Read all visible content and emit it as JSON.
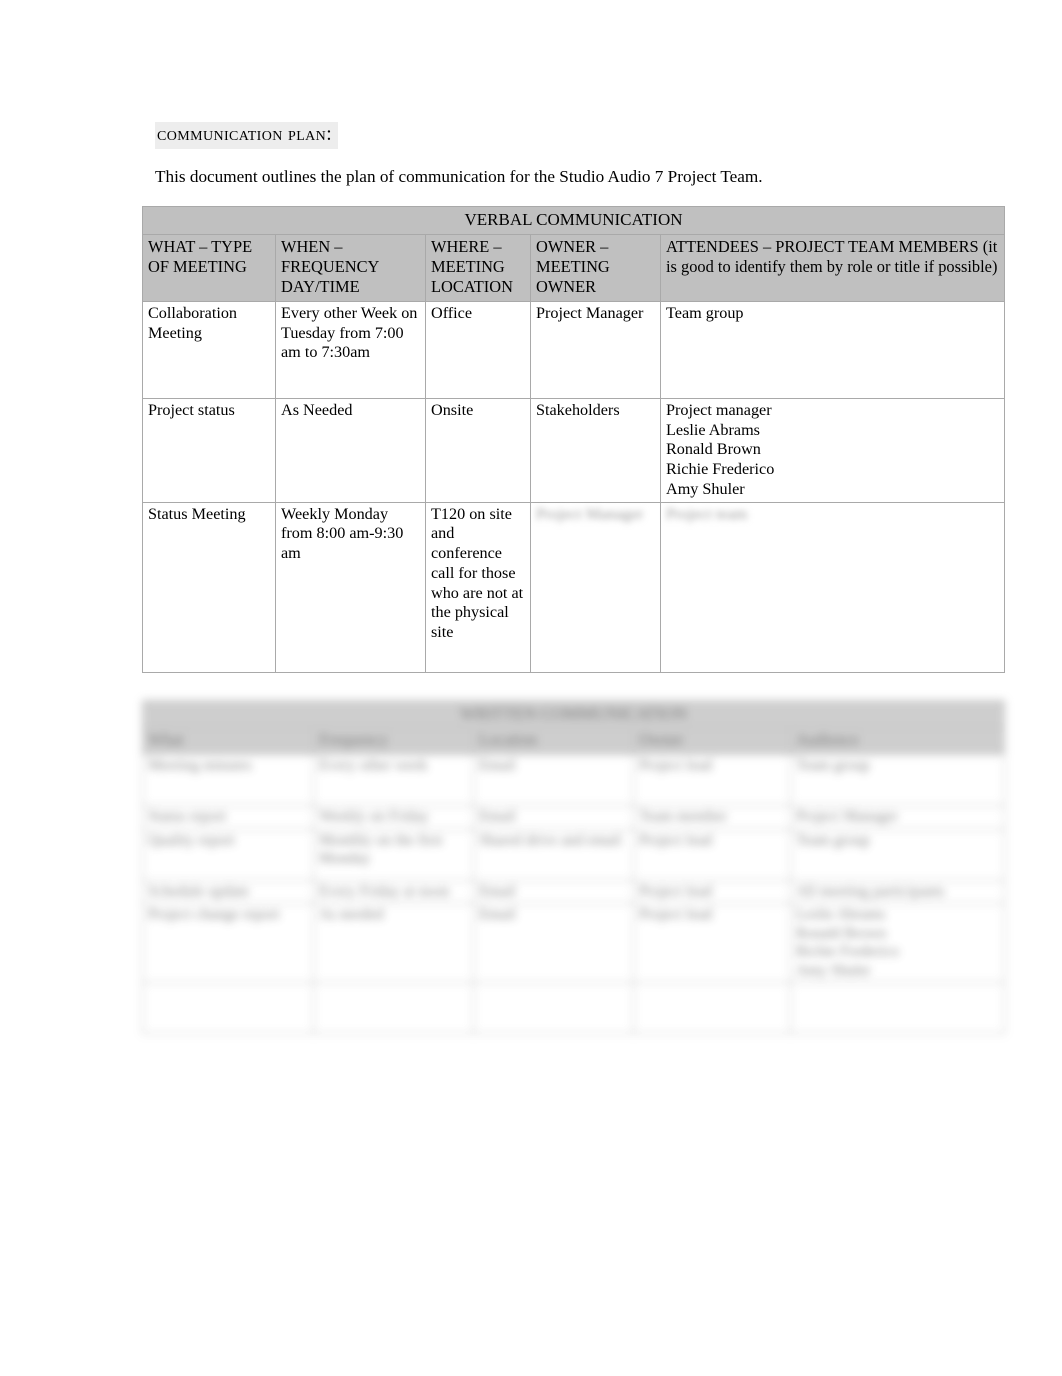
{
  "document": {
    "title": "Communication Plan:",
    "intro": "This document outlines the plan of communication for the Studio Audio 7 Project Team."
  },
  "colors": {
    "header_fill": "#c0c0c0",
    "border": "#a9a9a9",
    "title_shading": "#ededed",
    "text": "#000000"
  },
  "verbal_table": {
    "banner": "VERBAL COMMUNICATION",
    "columns": [
      "WHAT – TYPE OF MEETING",
      "WHEN – FREQUENCY DAY/TIME",
      "WHERE – MEETING LOCATION",
      "OWNER – MEETING OWNER",
      "ATTENDEES – PROJECT TEAM MEMBERS (it is good to identify them by role or title if possible)"
    ],
    "rows": [
      {
        "what": "Collaboration Meeting",
        "when": "Every other Week on Tuesday from 7:00 am to 7:30am",
        "where": "Office",
        "owner": "Project Manager",
        "attendees": "Team group"
      },
      {
        "what": "Project status",
        "when": "As Needed",
        "where": "Onsite",
        "owner": "Stakeholders",
        "attendees": "Project manager\nLeslie Abrams\nRonald Brown\nRichie Frederico\nAmy Shuler"
      },
      {
        "what": "Status Meeting",
        "when": "Weekly Monday from 8:00 am-9:30 am",
        "where": "T120 on site and conference call for those who are not at the physical site",
        "owner": "Project Manager",
        "attendees": "Project team"
      }
    ]
  },
  "written_table": {
    "banner": "WRITTEN COMMUNICATION",
    "illegible": true,
    "columns": [
      "What",
      "Frequency",
      "Location",
      "Owner",
      "Audience"
    ],
    "rows": [
      {
        "c1": "Meeting minutes",
        "c2": "Every other week",
        "c3": "Email",
        "c4": "Project lead",
        "c5": "Team group"
      },
      {
        "c1": "Status report",
        "c2": "Weekly on Friday",
        "c3": "Email",
        "c4": "Team member",
        "c5": "Project Manager"
      },
      {
        "c1": "Quality report",
        "c2": "Monthly on the first Monday",
        "c3": "Shared drive and email",
        "c4": "Project lead",
        "c5": "Team group"
      },
      {
        "c1": "Schedule update",
        "c2": "Every Friday at noon",
        "c3": "Email",
        "c4": "Project lead",
        "c5": "All meeting participants"
      },
      {
        "c1": "Project change report",
        "c2": "As needed",
        "c3": "Email",
        "c4": "Project lead",
        "c5": "Leslie Abrams\nRonald Brown\nRichie Frederico\nAmy Shuler"
      },
      {
        "c1": "",
        "c2": "",
        "c3": "",
        "c4": "",
        "c5": ""
      }
    ]
  }
}
